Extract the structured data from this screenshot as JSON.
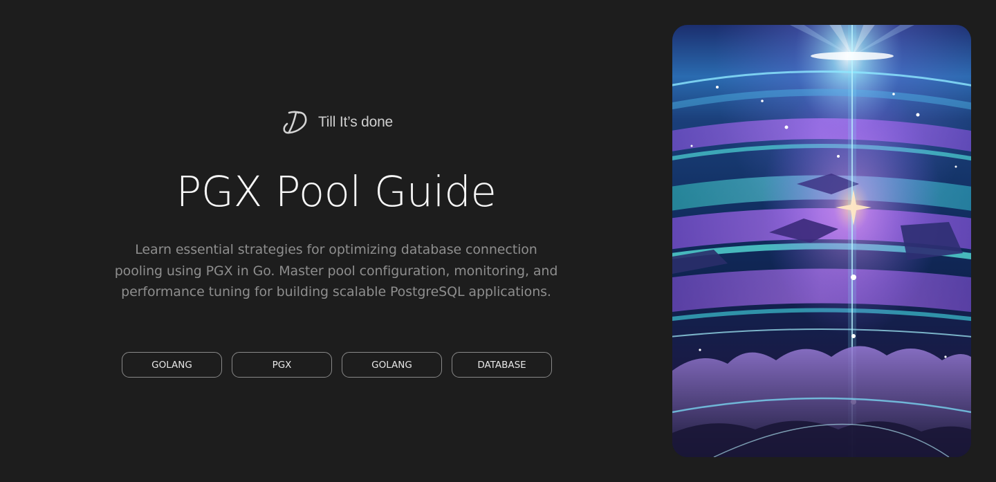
{
  "brand": {
    "name": "Till It’s done",
    "logo_icon": "td-monogram-icon"
  },
  "hero": {
    "title": "PGX Pool Guide",
    "description": "Learn essential strategies for optimizing database connection pooling using PGX in Go. Master pool configuration, monitoring, and performance tuning for building scalable PostgreSQL applications."
  },
  "tags": [
    {
      "label": "GOLANG"
    },
    {
      "label": "PGX"
    },
    {
      "label": "GOLANG"
    },
    {
      "label": "DATABASE"
    }
  ],
  "colors": {
    "background": "#1d1d1d",
    "title": "#f7f7f7",
    "description": "#8e8e8e",
    "tag_border": "#8a8a8a"
  }
}
